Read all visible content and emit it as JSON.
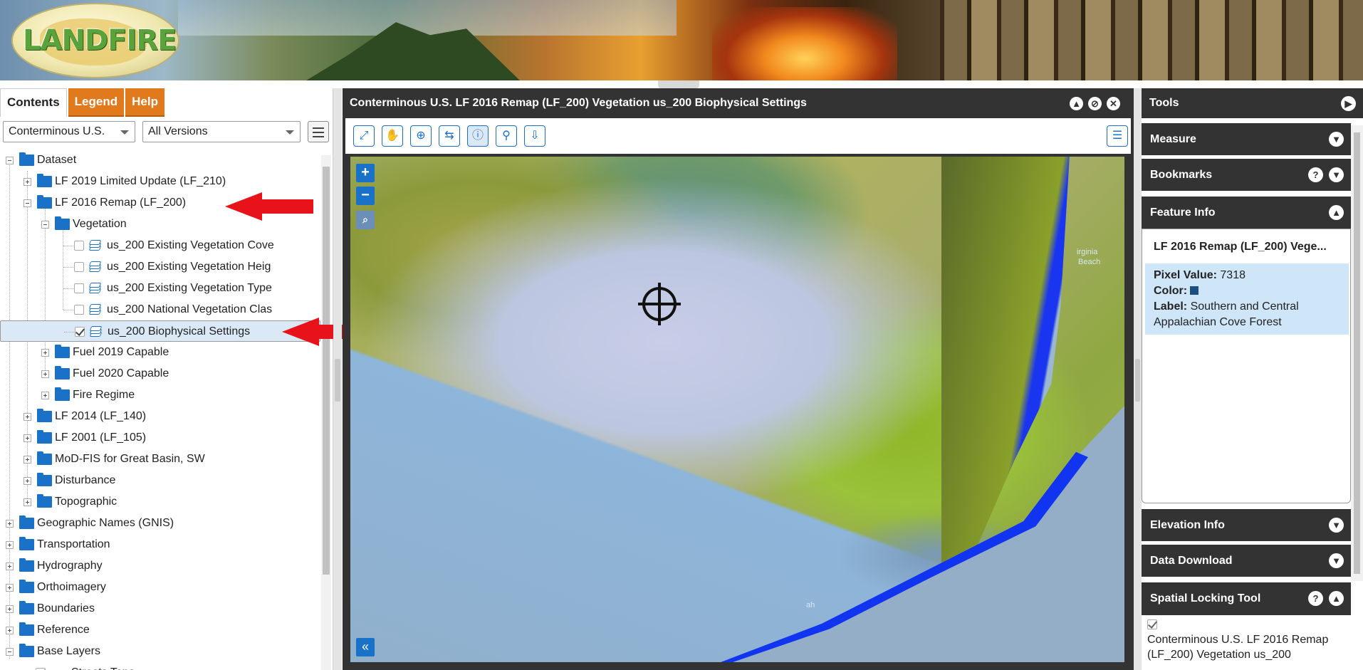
{
  "header": {
    "logo_text": "LANDFIRE"
  },
  "tabs": [
    {
      "label": "Contents",
      "active": true
    },
    {
      "label": "Legend",
      "active": false
    },
    {
      "label": "Help",
      "active": false
    }
  ],
  "filters": {
    "region": "Conterminous U.S.",
    "version": "All Versions"
  },
  "tree": {
    "dataset": "Dataset",
    "lf210": "LF 2019 Limited Update (LF_210)",
    "lf200": "LF 2016 Remap (LF_200)",
    "vegetation": "Vegetation",
    "evc": "us_200 Existing Vegetation Cove",
    "evh": "us_200 Existing Vegetation Heig",
    "evt": "us_200 Existing Vegetation Type",
    "nvc": "us_200 National Vegetation Clas",
    "bps": "us_200 Biophysical Settings",
    "fuel2019": "Fuel 2019 Capable",
    "fuel2020": "Fuel 2020 Capable",
    "fire_regime": "Fire Regime",
    "lf140": "LF 2014 (LF_140)",
    "lf105": "LF 2001 (LF_105)",
    "modfis": "MoD-FIS for Great Basin, SW",
    "disturbance": "Disturbance",
    "topographic": "Topographic",
    "gnis": "Geographic Names (GNIS)",
    "transportation": "Transportation",
    "hydrography": "Hydrography",
    "orthoimagery": "Orthoimagery",
    "boundaries": "Boundaries",
    "reference": "Reference",
    "base_layers": "Base Layers",
    "streets": "Streets Topo..."
  },
  "map": {
    "title": "Conterminous U.S. LF 2016 Remap (LF_200) Vegetation us_200 Biophysical Settings",
    "zoom_in": "+",
    "zoom_out": "−",
    "collapse": "«",
    "town1": "irginia",
    "town2": "Beach",
    "town3": "ah"
  },
  "tools": {
    "title": "Tools",
    "measure": "Measure",
    "bookmarks": "Bookmarks",
    "feature_info": "Feature Info",
    "elevation_info": "Elevation Info",
    "data_download": "Data Download",
    "spatial_locking": "Spatial Locking Tool",
    "help": "?"
  },
  "feature_info": {
    "title": "LF 2016 Remap (LF_200) Vege...",
    "pixel_value_label": "Pixel Value:",
    "pixel_value": "7318",
    "color_label": "Color:",
    "color": "#1b4f80",
    "label_label": "Label:",
    "label_line1": "Southern and Central",
    "label_line2": "Appalachian Cove Forest"
  },
  "spatial_locking": {
    "line1": "Conterminous U.S. LF 2016 Remap",
    "line2": "(LF_200) Vegetation us_200"
  },
  "colors": {
    "accent": "#1a72c8",
    "tab_orange": "#e07a1c",
    "arrow": "#e8131a",
    "header_dark": "#333333"
  }
}
